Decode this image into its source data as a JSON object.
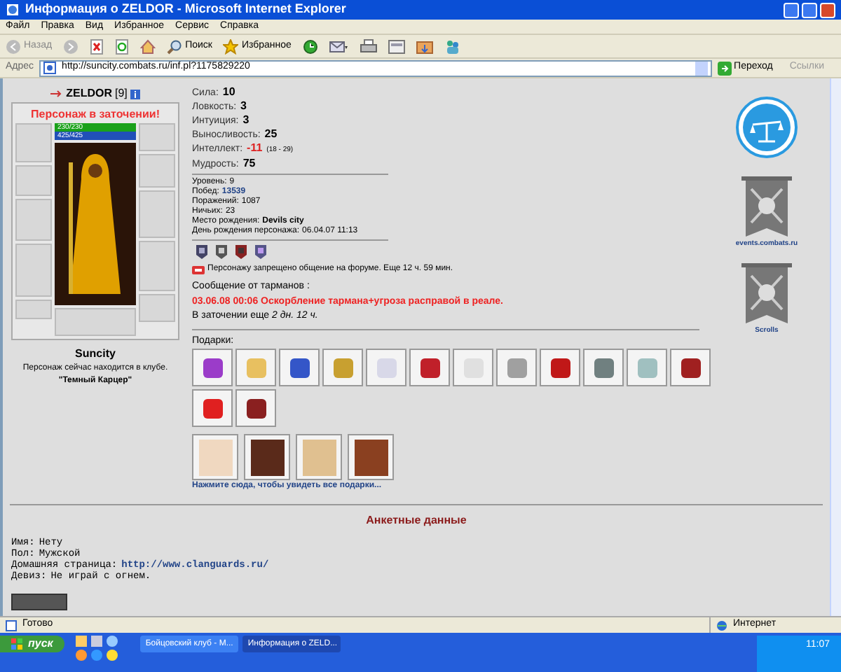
{
  "window": {
    "title": "Информация о ZELDOR - Microsoft Internet Explorer"
  },
  "menu": [
    "Файл",
    "Правка",
    "Вид",
    "Избранное",
    "Сервис",
    "Справка"
  ],
  "toolbar": {
    "back": "Назад",
    "search": "Поиск",
    "favorites": "Избранное"
  },
  "address": {
    "label": "Адрес",
    "url": "http://suncity.combats.ru/inf.pl?1175829220",
    "go": "Переход",
    "links": "Ссылки"
  },
  "character": {
    "name": "ZELDOR",
    "level": "[9]",
    "status": "Персонаж в заточении!",
    "city": "Suncity",
    "location_note": "Персонаж сейчас находится в клубе.",
    "location": "\"Темный Карцер\"",
    "bars": [
      {
        "kind": "hp",
        "label": "230/230",
        "level": 1
      },
      {
        "kind": "mana",
        "label": "425/425",
        "level": 1
      }
    ]
  },
  "stats": [
    {
      "label": "Сила:",
      "value": "10",
      "kind": "normal"
    },
    {
      "label": "Ловкость:",
      "value": "3",
      "kind": "normal"
    },
    {
      "label": "Интуиция:",
      "value": "3",
      "kind": "normal"
    },
    {
      "label": "Выносливость:",
      "value": "25",
      "kind": "normal"
    },
    {
      "label": "Интеллект:",
      "value": "-11",
      "kind": "penalty",
      "note": "(18 - 29)"
    },
    {
      "label": "Мудрость:",
      "value": "75",
      "kind": "normal"
    }
  ],
  "info": [
    {
      "label": "Уровень:",
      "value": "9",
      "kind": "plain"
    },
    {
      "label": "Побед:",
      "value": "13539",
      "kind": "link"
    },
    {
      "label": "Поражений:",
      "value": "1087",
      "kind": "plain"
    },
    {
      "label": "Ничьих:",
      "value": "23",
      "kind": "plain"
    },
    {
      "label": "Место рождения:",
      "value": "Devils city",
      "kind": "bold"
    },
    {
      "label": "День рождения персонажа:",
      "value": "06.04.07 11:13",
      "kind": "plain"
    }
  ],
  "forum_ban": "Персонажу запрещено общение на форуме. Еще 12 ч. 59 мин.",
  "message": {
    "heading": "Сообщение от тарманов :",
    "text": "03.06.08 00:06 Оскорбление тармана+угроза расправой в реале.",
    "term": "В заточении еще *2 дн. 12 ч.*"
  },
  "gifts": {
    "label": "Подарки:",
    "link": "Нажмите сюда, чтобы увидеть все подарки..."
  },
  "side_links": [
    "events.combats.ru",
    "Scrolls"
  ],
  "profile": {
    "heading": "Анкетные данные",
    "fields": [
      {
        "label": "Имя:",
        "value": "Нету",
        "kind": "plain"
      },
      {
        "label": "Пол:",
        "value": "Мужской",
        "kind": "plain"
      },
      {
        "label": "Домашняя страница:",
        "value": "http://www.clanguards.ru/",
        "kind": "link"
      },
      {
        "label": "Девиз:",
        "value": "Не играй с огнем.",
        "kind": "plain"
      }
    ]
  },
  "status_bar": {
    "text": "Готово",
    "zone": "Интернет"
  },
  "taskbar": {
    "start": "пуск",
    "tasks": [
      {
        "label": "Бойцовский клуб - M...",
        "selected": false
      },
      {
        "label": "Информация о ZELD...",
        "selected": true
      }
    ],
    "clock": "11:07"
  }
}
